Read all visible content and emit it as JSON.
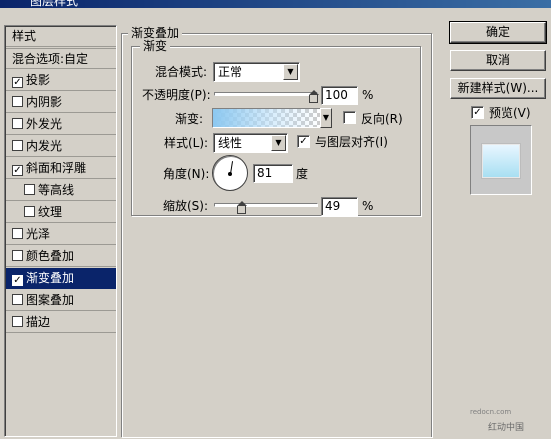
{
  "window": {
    "title": "图层样式"
  },
  "styles_list": {
    "header": "样式",
    "blend_options": "混合选项:自定",
    "items": [
      {
        "label": "投影",
        "checked": true,
        "indent": false,
        "selected": false
      },
      {
        "label": "内阴影",
        "checked": false,
        "indent": false,
        "selected": false
      },
      {
        "label": "外发光",
        "checked": false,
        "indent": false,
        "selected": false
      },
      {
        "label": "内发光",
        "checked": false,
        "indent": false,
        "selected": false
      },
      {
        "label": "斜面和浮雕",
        "checked": true,
        "indent": false,
        "selected": false
      },
      {
        "label": "等高线",
        "checked": false,
        "indent": true,
        "selected": false
      },
      {
        "label": "纹理",
        "checked": false,
        "indent": true,
        "selected": false
      },
      {
        "label": "光泽",
        "checked": false,
        "indent": false,
        "selected": false
      },
      {
        "label": "颜色叠加",
        "checked": false,
        "indent": false,
        "selected": false
      },
      {
        "label": "渐变叠加",
        "checked": true,
        "indent": false,
        "selected": true
      },
      {
        "label": "图案叠加",
        "checked": false,
        "indent": false,
        "selected": false
      },
      {
        "label": "描边",
        "checked": false,
        "indent": false,
        "selected": false
      }
    ]
  },
  "gradient_overlay": {
    "section_title": "渐变叠加",
    "group_title": "渐变",
    "blend_mode_label": "混合模式:",
    "blend_mode_value": "正常",
    "opacity_label": "不透明度(P):",
    "opacity_value": "100",
    "opacity_unit": "%",
    "opacity_fraction": 1.0,
    "gradient_label": "渐变:",
    "reverse_label": "反向(R)",
    "reverse_checked": false,
    "style_label": "样式(L):",
    "style_value": "线性",
    "align_label": "与图层对齐(I)",
    "align_checked": true,
    "angle_label": "角度(N):",
    "angle_value": "81",
    "angle_unit": "度",
    "scale_label": "缩放(S):",
    "scale_value": "49",
    "scale_unit": "%",
    "scale_fraction": 0.49
  },
  "buttons": {
    "ok": "确定",
    "cancel": "取消",
    "new_style": "新建样式(W)...",
    "preview_label": "预览(V)",
    "preview_checked": true
  },
  "watermark": {
    "text": "红动中国",
    "url_text": "redocn.com"
  }
}
